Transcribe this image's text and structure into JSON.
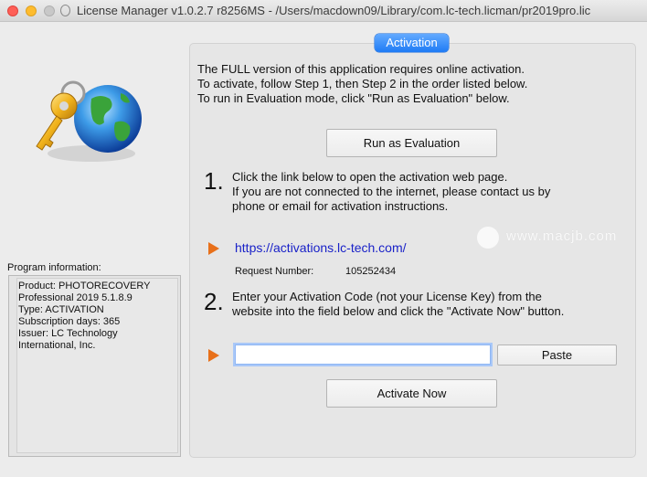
{
  "window": {
    "title": "License Manager v1.0.2.7 r8256MS - /Users/macdown09/Library/com.lc-tech.licman/pr2019pro.lic"
  },
  "program_info": {
    "label": "Program information:",
    "lines": [
      "Product: PHOTORECOVERY",
      "Professional 2019 5.1.8.9",
      "Type: ACTIVATION",
      "Subscription days: 365",
      "Issuer: LC Technology",
      "International, Inc."
    ]
  },
  "activation": {
    "tab_label": "Activation",
    "intro": [
      "The FULL version of this application requires online activation.",
      "To activate, follow Step 1, then Step 2 in the order listed below.",
      "To run in Evaluation mode, click \"Run as Evaluation\" below."
    ],
    "run_eval_label": "Run as Evaluation",
    "step1": {
      "number": "1.",
      "lines": [
        "Click the link below to open the activation web page.",
        "If you are not connected to the internet, please contact us by",
        "phone or email for activation instructions."
      ]
    },
    "link_text": "https://activations.lc-tech.com/",
    "request_label": "Request Number:",
    "request_value": "105252434",
    "step2": {
      "number": "2.",
      "lines": [
        "Enter your Activation Code (not your License Key) from the",
        "website into the field below and click the \"Activate Now\" button."
      ]
    },
    "code_value": "",
    "paste_label": "Paste",
    "activate_label": "Activate Now"
  },
  "watermark": {
    "text": "www.macjb.com"
  },
  "colors": {
    "accent": "#1e7bf5",
    "arrow": "#e8701a",
    "link": "#1a22c8"
  },
  "icons": [
    "close-icon",
    "minimize-icon",
    "maximize-icon",
    "document-icon",
    "key-globe-logo",
    "play-arrow-icon",
    "heart-badge-icon"
  ]
}
